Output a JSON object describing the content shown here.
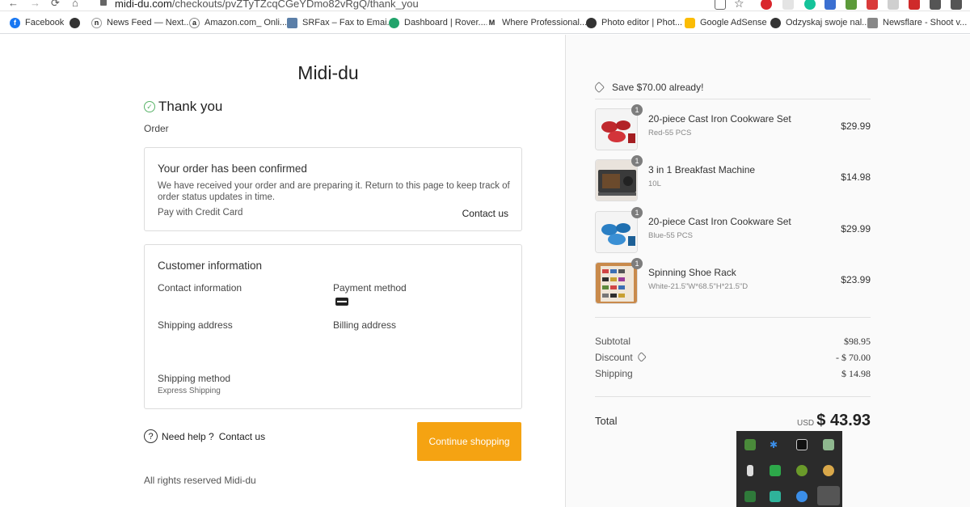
{
  "browser": {
    "url_host": "midi-du.com",
    "url_path": "/checkouts/pvZTyTZcqCGeYDmo82vRgQ/thank_you",
    "nav": {
      "back": "←",
      "forward": "→",
      "reload": "⟳",
      "home": "⌂"
    },
    "bookmarks": [
      {
        "label": "Facebook",
        "icon": "facebook-icon",
        "color": "#1877f2",
        "glyph": "f"
      },
      {
        "label": "News Feed — Next...",
        "icon": "globe-icon",
        "color": "#333333",
        "glyph": ""
      },
      {
        "label": "Amazon.com_ Onli...",
        "icon": "amazon-icon",
        "color": "#222222",
        "glyph": "a"
      },
      {
        "label": "SRFax – Fax to Emai...",
        "icon": "srfax-icon",
        "color": "#5b7fa8",
        "glyph": ""
      },
      {
        "label": "Dashboard | Rover....",
        "icon": "paw-icon",
        "color": "#21a36b",
        "glyph": ""
      },
      {
        "label": "Where Professional...",
        "icon": "m-icon",
        "color": "#222222",
        "glyph": "M"
      },
      {
        "label": "Photo editor | Phot...",
        "icon": "globe-icon",
        "color": "#333333",
        "glyph": ""
      },
      {
        "label": "Google AdSense",
        "icon": "adsense-icon",
        "color": "#fbbc05",
        "glyph": ""
      },
      {
        "label": "Odzyskaj swoje nal...",
        "icon": "globe-icon",
        "color": "#333333",
        "glyph": ""
      },
      {
        "label": "Newsflare - Shoot v...",
        "icon": "newsflare-icon",
        "color": "#888888",
        "glyph": ""
      }
    ]
  },
  "checkout": {
    "store_name": "Midi-du",
    "thank_you": "Thank you",
    "order_label": "Order",
    "confirmation": {
      "title": "Your order has been confirmed",
      "message": "We have received your order and are preparing it. Return to this page to keep track of order status updates in time.",
      "pay_label": "Pay with Credit Card",
      "contact_link": "Contact us"
    },
    "customer": {
      "title": "Customer information",
      "contact_info": "Contact information",
      "payment_method": "Payment method",
      "shipping_address": "Shipping address",
      "billing_address": "Billing address",
      "shipping_method": "Shipping method",
      "shipping_method_value": "Express Shipping"
    },
    "help": {
      "label": "Need help ?",
      "link": "Contact us"
    },
    "continue_button": "Continue shopping",
    "footer": "All rights reserved Midi-du"
  },
  "summary": {
    "save_text": "Save $70.00 already!",
    "items": [
      {
        "qty": "1",
        "name": "20-piece Cast Iron Cookware Set",
        "variant": "Red-55 PCS",
        "price": "$29.99",
        "thumb": "red-cookware",
        "thumb_color": "#c0282d"
      },
      {
        "qty": "1",
        "name": "3 in 1 Breakfast Machine",
        "variant": "10L",
        "price": "$14.98",
        "thumb": "breakfast-machine",
        "thumb_color": "#3a3a3a"
      },
      {
        "qty": "1",
        "name": "20-piece Cast Iron Cookware Set",
        "variant": "Blue-55 PCS",
        "price": "$29.99",
        "thumb": "blue-cookware",
        "thumb_color": "#2a7fc4"
      },
      {
        "qty": "1",
        "name": "Spinning Shoe Rack",
        "variant": "White-21.5\"W*68.5\"H*21.5\"D",
        "price": "$23.99",
        "thumb": "shoe-rack",
        "thumb_color": "#c98a4b"
      }
    ],
    "subtotal_label": "Subtotal",
    "subtotal": "$98.95",
    "discount_label": "Discount",
    "discount": "- $ 70.00",
    "shipping_label": "Shipping",
    "shipping": "$ 14.98",
    "total_label": "Total",
    "currency": "USD",
    "total": "$ 43.93"
  },
  "colors": {
    "accent": "#f5a312",
    "success": "#58b368"
  }
}
